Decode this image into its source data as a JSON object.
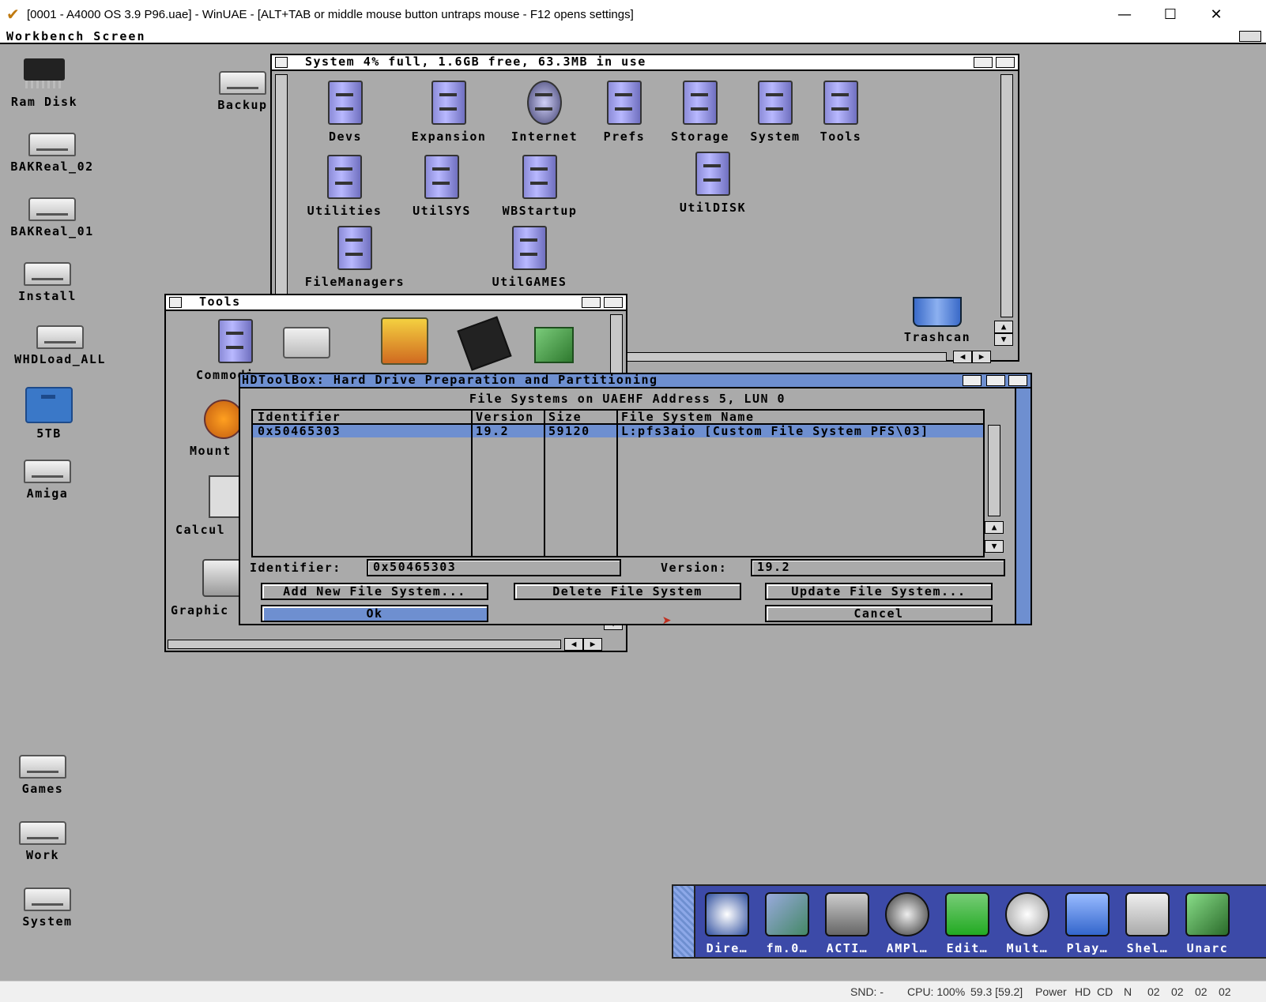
{
  "host": {
    "title": "[0001 - A4000 OS 3.9 P96.uae] - WinUAE - [ALT+TAB or middle mouse button untraps mouse - F12 opens settings]",
    "minimize": "—",
    "maximize": "☐",
    "close": "✕"
  },
  "screen": {
    "title": "Workbench Screen"
  },
  "desktop_icons": [
    {
      "label": "Ram Disk",
      "icon": "chip-icon"
    },
    {
      "label": "BAKReal_02",
      "icon": "drive-icon"
    },
    {
      "label": "BAKReal_01",
      "icon": "drive-icon"
    },
    {
      "label": "Install",
      "icon": "drive-icon"
    },
    {
      "label": "WHDLoad_ALL",
      "icon": "drive-icon"
    },
    {
      "label": "5TB",
      "icon": "drawer-icon"
    },
    {
      "label": "Amiga",
      "icon": "drive-icon"
    },
    {
      "label": "Games",
      "icon": "drive-icon"
    },
    {
      "label": "Work",
      "icon": "drive-icon"
    },
    {
      "label": "System",
      "icon": "drive-icon"
    },
    {
      "label": "Backup",
      "icon": "drive-icon"
    },
    {
      "label": "Trashcan",
      "icon": "trashcan-icon"
    }
  ],
  "system_window": {
    "title": "System  4% full, 1.6GB free, 63.3MB in use",
    "items": [
      "Devs",
      "Expansion",
      "Internet",
      "Prefs",
      "Storage",
      "System",
      "Tools",
      "Utilities",
      "UtilSYS",
      "WBStartup",
      "UtilDISK",
      "FileManagers",
      "UtilGAMES"
    ]
  },
  "tools_window": {
    "title": "Tools",
    "items": [
      "Commodi",
      "Mount",
      "Calcul",
      "Graphic"
    ]
  },
  "hdtoolbox": {
    "title": "HDToolBox: Hard Drive Preparation and Partitioning",
    "heading": "File Systems on UAEHF Address 5, LUN 0",
    "columns": [
      "Identifier",
      "Version",
      "Size",
      "File System Name"
    ],
    "rows": [
      {
        "identifier": "0x50465303",
        "version": "19.2",
        "size": "59120",
        "name": "L:pfs3aio [Custom File System PFS\\03]"
      }
    ],
    "identifier_label": "Identifier:",
    "identifier_value": "0x50465303",
    "version_label": "Version:",
    "version_value": "19.2",
    "buttons": {
      "add": "Add New File System...",
      "delete": "Delete File System",
      "update": "Update File System...",
      "ok": "Ok",
      "cancel": "Cancel"
    }
  },
  "dock": {
    "items": [
      "Dire…",
      "fm.0…",
      "ACTI…",
      "AMPl…",
      "Edit…",
      "Mult…",
      "Play…",
      "Shel…",
      "Unarc"
    ]
  },
  "statusbar": {
    "snd": "SND: -",
    "cpu": "CPU: 100%",
    "fps": "59.3 [59.2]",
    "power": "Power",
    "hd": "HD",
    "cd": "CD",
    "n": "N",
    "df0": "02",
    "df1": "02",
    "df2": "02",
    "df3": "02"
  },
  "colors": {
    "workbench_gray": "#aaaaaa",
    "amiga_blue": "#6e8fd0",
    "dock_blue": "#3c4aa8"
  }
}
